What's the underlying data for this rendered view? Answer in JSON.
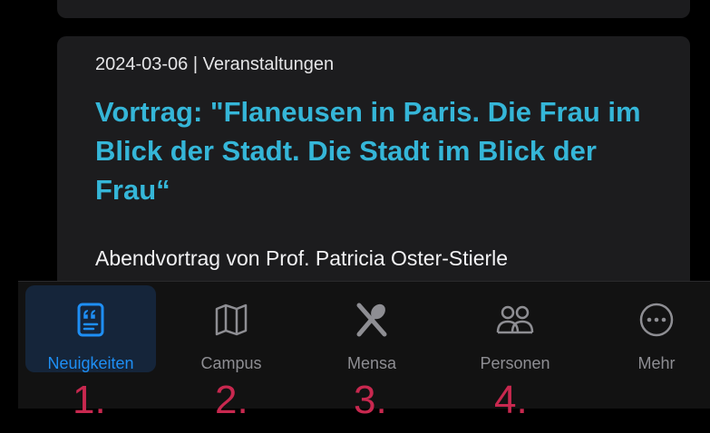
{
  "article": {
    "meta": "2024-03-06 | Veranstaltungen",
    "title": "Vortrag: \"Flaneusen in Paris. Die Frau im Blick der Stadt. Die Stadt im Blick der Frau“",
    "teaser": "Abendvortrag von Prof. Patricia Oster-Stierle"
  },
  "tabs": [
    {
      "label": "Neuigkeiten",
      "icon": "news-icon",
      "active": true
    },
    {
      "label": "Campus",
      "icon": "map-icon",
      "active": false
    },
    {
      "label": "Mensa",
      "icon": "fork-knife-icon",
      "active": false
    },
    {
      "label": "Personen",
      "icon": "people-icon",
      "active": false
    },
    {
      "label": "Mehr",
      "icon": "more-icon",
      "active": false
    }
  ],
  "annotations": [
    "1.",
    "2.",
    "3.",
    "4."
  ],
  "colors": {
    "accent": "#1e8ff5",
    "title": "#35b6d8",
    "annotation": "#c8284f",
    "card": "#1c1c1e"
  }
}
